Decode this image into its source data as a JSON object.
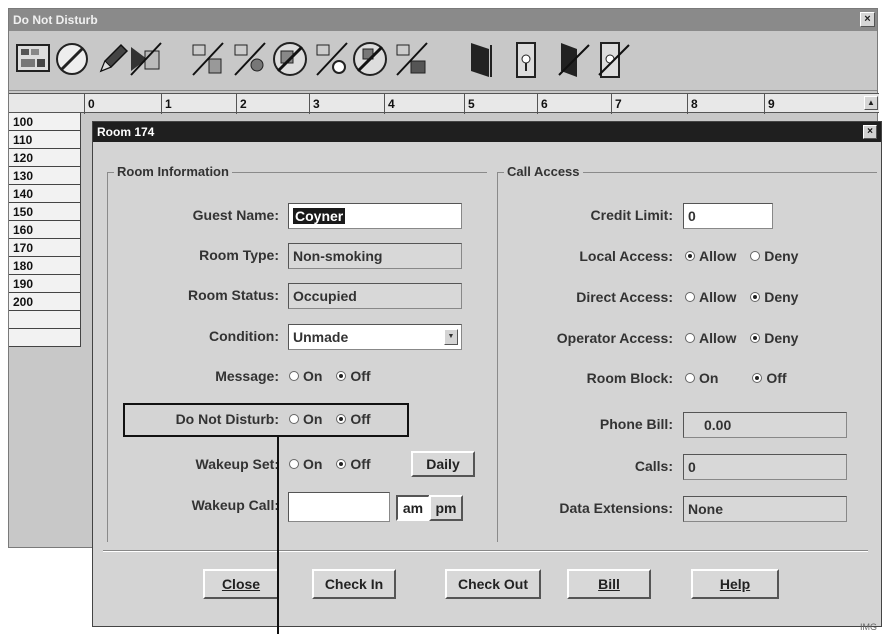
{
  "main_window": {
    "title": "Do Not Disturb",
    "close_glyph": "×"
  },
  "toolbar": {
    "icons": [
      "room-map-icon",
      "no-entry-icon",
      "pencil-icon",
      "maid-cancel-icon",
      "maid-1-icon",
      "maid-2-icon",
      "maid-no-icon",
      "maid-3-icon",
      "maid-4-icon",
      "maid-5-icon",
      "door-open-icon",
      "door-key-icon",
      "door-cancel-icon",
      "door-key-cancel-icon"
    ]
  },
  "grid": {
    "columns": [
      "0",
      "1",
      "2",
      "3",
      "4",
      "5",
      "6",
      "7",
      "8",
      "9"
    ],
    "rows": [
      "100",
      "110",
      "120",
      "130",
      "140",
      "150",
      "160",
      "170",
      "180",
      "190",
      "200",
      "",
      ""
    ],
    "scroll_glyph": "▲"
  },
  "dialog": {
    "title": "Room 174",
    "close_glyph": "×",
    "room_info": {
      "group_label": "Room Information",
      "guest_name_label": "Guest Name:",
      "guest_name_value": "Coyner",
      "room_type_label": "Room Type:",
      "room_type_value": "Non-smoking",
      "room_status_label": "Room Status:",
      "room_status_value": "Occupied",
      "condition_label": "Condition:",
      "condition_value": "Unmade",
      "message_label": "Message:",
      "message_on": "On",
      "message_off": "Off",
      "dnd_label": "Do Not Disturb:",
      "dnd_on": "On",
      "dnd_off": "Off",
      "wakeup_set_label": "Wakeup Set:",
      "wakeup_on": "On",
      "wakeup_off": "Off",
      "daily_label": "Daily",
      "wakeup_call_label": "Wakeup Call:",
      "wakeup_call_value": "",
      "am_label": "am",
      "pm_label": "pm"
    },
    "call_access": {
      "group_label": "Call Access",
      "credit_limit_label": "Credit Limit:",
      "credit_limit_value": "0",
      "local_access_label": "Local Access:",
      "direct_access_label": "Direct Access:",
      "operator_access_label": "Operator Access:",
      "allow": "Allow",
      "deny": "Deny",
      "room_block_label": "Room Block:",
      "room_block_on": "On",
      "room_block_off": "Off",
      "phone_bill_label": "Phone Bill:",
      "phone_bill_value": "0.00",
      "calls_label": "Calls:",
      "calls_value": "0",
      "data_ext_label": "Data Extensions:",
      "data_ext_value": "None"
    },
    "buttons": {
      "close": "Close",
      "check_in": "Check In",
      "check_out": "Check Out",
      "bill": "Bill",
      "help": "Help"
    }
  },
  "footer_mark": "IMG"
}
